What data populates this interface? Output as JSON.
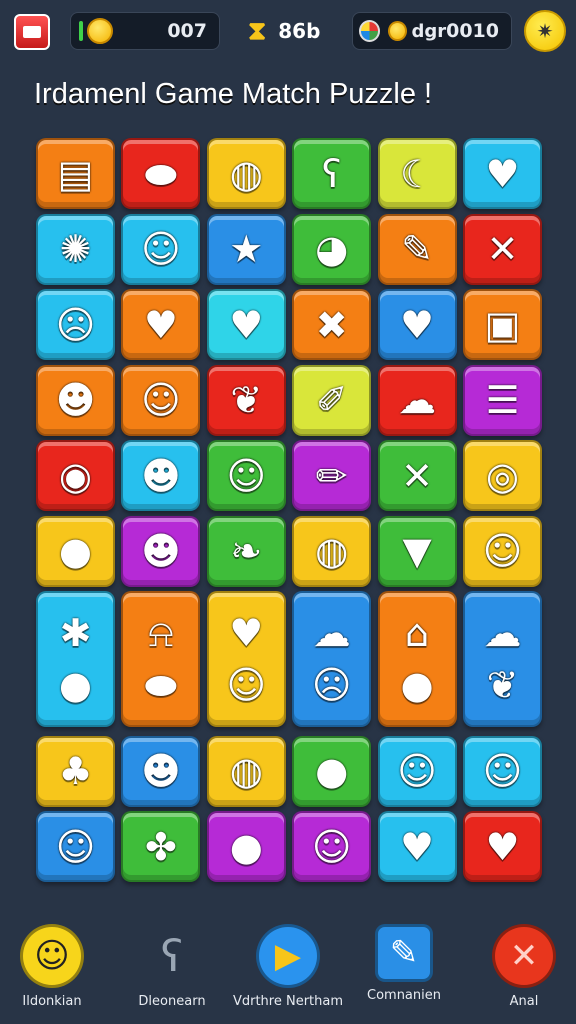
{
  "topbar": {
    "coins_value": "007",
    "center_value": "86b",
    "lives_text": "dgr",
    "lives_value": "0010"
  },
  "title": "Irdamenl Game Match Puzzle !",
  "board": {
    "colors": {
      "yellow": "#f7c61b",
      "red": "#e8261d",
      "orange": "#f47f14",
      "green": "#3fbd3a",
      "lime": "#d9e63a",
      "cyan": "#27c0ee",
      "blue": "#2a8fe6",
      "purple": "#b62ad6",
      "teal": "#2fd4e8"
    },
    "rows": [
      [
        {
          "color": "orange",
          "icon": "cake-icon",
          "glyph": "▤"
        },
        {
          "color": "red",
          "icon": "bread-icon",
          "glyph": "⬬"
        },
        {
          "color": "yellow",
          "icon": "seed-icon",
          "glyph": "◍"
        },
        {
          "color": "green",
          "icon": "bear-icon",
          "glyph": "ʕ"
        },
        {
          "color": "lime",
          "icon": "banana-icon",
          "glyph": "☾"
        },
        {
          "color": "cyan",
          "icon": "heart-icon",
          "glyph": "♥"
        }
      ],
      [
        {
          "color": "cyan",
          "icon": "hedgehog-icon",
          "glyph": "✺"
        },
        {
          "color": "cyan",
          "icon": "smiley-bear-icon",
          "glyph": "☺"
        },
        {
          "color": "blue",
          "icon": "star-icon",
          "glyph": "★"
        },
        {
          "color": "green",
          "icon": "fish-icon",
          "glyph": "◕"
        },
        {
          "color": "orange",
          "icon": "ice-cream-icon",
          "glyph": "✎"
        },
        {
          "color": "red",
          "icon": "crossed-sticks-icon",
          "glyph": "✕"
        }
      ],
      [
        {
          "color": "cyan",
          "icon": "devil-icon",
          "glyph": "☹"
        },
        {
          "color": "orange",
          "icon": "heart-icon",
          "glyph": "♥"
        },
        {
          "color": "teal",
          "icon": "heart-icon",
          "glyph": "♥"
        },
        {
          "color": "orange",
          "icon": "crossed-sticks-icon",
          "glyph": "✖"
        },
        {
          "color": "blue",
          "icon": "heart-icon",
          "glyph": "♥"
        },
        {
          "color": "orange",
          "icon": "block-icon",
          "glyph": "▣"
        }
      ],
      [
        {
          "color": "orange",
          "icon": "frog-icon",
          "glyph": "☻"
        },
        {
          "color": "orange",
          "icon": "face-icon",
          "glyph": "☺"
        },
        {
          "color": "red",
          "icon": "leaf-icon",
          "glyph": "❦"
        },
        {
          "color": "lime",
          "icon": "rocket-icon",
          "glyph": "✐"
        },
        {
          "color": "red",
          "icon": "cloud-icon",
          "glyph": "☁"
        },
        {
          "color": "purple",
          "icon": "cake-icon",
          "glyph": "☰"
        }
      ],
      [
        {
          "color": "red",
          "icon": "snail-icon",
          "glyph": "◉"
        },
        {
          "color": "cyan",
          "icon": "frog-icon",
          "glyph": "☻"
        },
        {
          "color": "green",
          "icon": "face-icon",
          "glyph": "☺"
        },
        {
          "color": "purple",
          "icon": "pencil-icon",
          "glyph": "✏"
        },
        {
          "color": "green",
          "icon": "crossed-sticks-icon",
          "glyph": "✕"
        },
        {
          "color": "yellow",
          "icon": "eye-icon",
          "glyph": "◎"
        }
      ],
      [
        {
          "color": "yellow",
          "icon": "orange-fruit-icon",
          "glyph": "●"
        },
        {
          "color": "purple",
          "icon": "frog-icon",
          "glyph": "☻"
        },
        {
          "color": "green",
          "icon": "leaf-icon",
          "glyph": "❧"
        },
        {
          "color": "yellow",
          "icon": "seed-icon",
          "glyph": "◍"
        },
        {
          "color": "green",
          "icon": "ice-cream-icon",
          "glyph": "▼"
        },
        {
          "color": "yellow",
          "icon": "smiley-icon",
          "glyph": "☺"
        }
      ],
      [
        {
          "color": "cyan",
          "icon": "fries-icon",
          "glyph": "✱",
          "tall": true,
          "glyph2": "●",
          "icon2": "egg-icon"
        },
        {
          "color": "orange",
          "icon": "bell-icon",
          "glyph": "⍾",
          "tall": true,
          "glyph2": "⬬",
          "icon2": "lips-icon"
        },
        {
          "color": "yellow",
          "icon": "cat-icon",
          "glyph": "♥",
          "tall": true,
          "glyph2": "☺",
          "icon2": "kitten-icon"
        },
        {
          "color": "blue",
          "icon": "sheep-icon",
          "glyph": "☁",
          "tall": true,
          "glyph2": "☹",
          "icon2": "devil-icon"
        },
        {
          "color": "orange",
          "icon": "jelly-icon",
          "glyph": "⌂",
          "tall": true,
          "glyph2": "●",
          "icon2": "ball-icon"
        },
        {
          "color": "blue",
          "icon": "mushroom-icon",
          "glyph": "☁",
          "tall": true,
          "glyph2": "❦",
          "icon2": "leaf-icon"
        }
      ],
      [
        {
          "color": "yellow",
          "icon": "clover-icon",
          "glyph": "♣"
        },
        {
          "color": "blue",
          "icon": "devil-icon",
          "glyph": "☻"
        },
        {
          "color": "yellow",
          "icon": "seed-icon",
          "glyph": "◍"
        },
        {
          "color": "green",
          "icon": "balloon-icon",
          "glyph": "●"
        },
        {
          "color": "cyan",
          "icon": "ghost-icon",
          "glyph": "☺"
        },
        {
          "color": "cyan",
          "icon": "face-icon",
          "glyph": "☺"
        }
      ],
      [
        {
          "color": "blue",
          "icon": "face-icon",
          "glyph": "☺"
        },
        {
          "color": "green",
          "icon": "leaf-icon",
          "glyph": "✤"
        },
        {
          "color": "purple",
          "icon": "fish-icon",
          "glyph": "●"
        },
        {
          "color": "purple",
          "icon": "smiley-icon",
          "glyph": "☺"
        },
        {
          "color": "cyan",
          "icon": "radish-icon",
          "glyph": "♥"
        },
        {
          "color": "red",
          "icon": "strawberry-icon",
          "glyph": "♥"
        }
      ]
    ]
  },
  "bottom_buttons": [
    {
      "label": "Ildonkian",
      "icon": "smiley-icon",
      "glyph": "☺",
      "bg": "#f7d51b",
      "shape": "circle"
    },
    {
      "label": "Dleonearn",
      "icon": "cat-icon",
      "glyph": "ʕ",
      "bg": "#9aa6b4",
      "shape": "none"
    },
    {
      "label": "Vdrthre Nertham",
      "icon": "play-icon",
      "glyph": "▶",
      "bg": "#2a93ee",
      "shape": "circle"
    },
    {
      "label": "Comnanien",
      "icon": "mushroom-icon",
      "glyph": "✎",
      "bg": "#2a8fe6",
      "shape": "square"
    },
    {
      "label": "Anal",
      "icon": "close-icon",
      "glyph": "✕",
      "bg": "#e8361d",
      "shape": "circle"
    }
  ]
}
